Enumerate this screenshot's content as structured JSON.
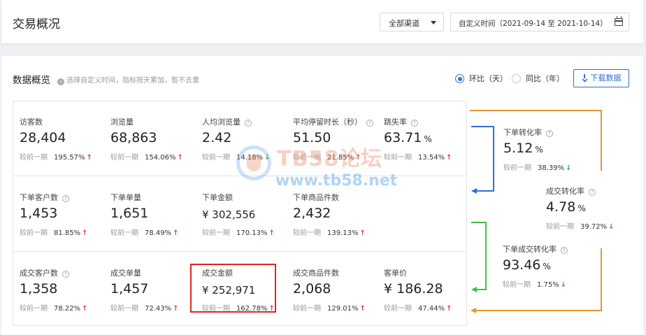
{
  "header": {
    "title": "交易概况",
    "channel_select": "全部渠道",
    "date_range": "自定义时间（2021-09-14 至 2021-10-14）"
  },
  "overview": {
    "title": "数据概览",
    "hint": "选择自定义时间，指标按天累加，暂不去重",
    "radio_day": "环比（天）",
    "radio_year": "同比（年）",
    "download": "下载数据",
    "compare_label": "较前一期"
  },
  "metrics": {
    "visitors": {
      "label": "访客数",
      "value": "28,404",
      "pct": "195.57%",
      "trend": "up"
    },
    "pageviews": {
      "label": "浏览量",
      "value": "68,863",
      "pct": "154.06%",
      "trend": "up"
    },
    "avg_pv": {
      "label": "人均浏览量",
      "value": "2.42",
      "pct": "14.18%",
      "trend": "down"
    },
    "avg_stay": {
      "label": "平均停留时长（秒）",
      "value": "51.50",
      "pct": "21.85%",
      "trend": "up"
    },
    "bounce": {
      "label": "跳失率",
      "value": "63.71",
      "unit": "%",
      "pct": "13.54%",
      "trend": "up"
    },
    "order_customers": {
      "label": "下单客户数",
      "value": "1,453",
      "pct": "81.85%",
      "trend": "up"
    },
    "order_count": {
      "label": "下单单量",
      "value": "1,651",
      "pct": "78.49%",
      "trend": "up"
    },
    "order_amount": {
      "label": "下单金额",
      "value": "¥ 302,556",
      "pct": "170.13%",
      "trend": "up"
    },
    "order_items": {
      "label": "下单商品件数",
      "value": "2,432",
      "pct": "139.13%",
      "trend": "up"
    },
    "deal_customers": {
      "label": "成交客户数",
      "value": "1,358",
      "pct": "78.22%",
      "trend": "up"
    },
    "deal_count": {
      "label": "成交单量",
      "value": "1,457",
      "pct": "72.43%",
      "trend": "up"
    },
    "deal_amount": {
      "label": "成交金额",
      "value": "¥ 252,971",
      "pct": "162.78%",
      "trend": "up"
    },
    "deal_items": {
      "label": "成交商品件数",
      "value": "2,068",
      "pct": "129.01%",
      "trend": "up"
    },
    "avg_order_value": {
      "label": "客单价",
      "value": "¥ 186.28",
      "pct": "47.44%",
      "trend": "up"
    }
  },
  "conversions": {
    "order_rate": {
      "label": "下单转化率",
      "value": "5.12",
      "unit": "%",
      "pct": "38.39%",
      "trend": "down"
    },
    "deal_rate": {
      "label": "成交转化率",
      "value": "4.78",
      "unit": "%",
      "pct": "39.72%",
      "trend": "down"
    },
    "order_deal_rate": {
      "label": "下单成交转化率",
      "value": "93.46",
      "unit": "%",
      "pct": "1.75%",
      "trend": "down"
    }
  },
  "watermark": {
    "line1": "TB58论坛",
    "line2": "www.tb58.net"
  },
  "colors": {
    "accent": "#2f6fd6",
    "up": "#e03a3a",
    "down": "#3aa93a",
    "orange_line": "#e8962c",
    "green_line": "#3cc43c",
    "blue_line": "#2f6fd6",
    "highlight": "#e02424"
  },
  "symbols": {
    "up": "↑",
    "down": "↓",
    "question": "?",
    "info": "i"
  }
}
